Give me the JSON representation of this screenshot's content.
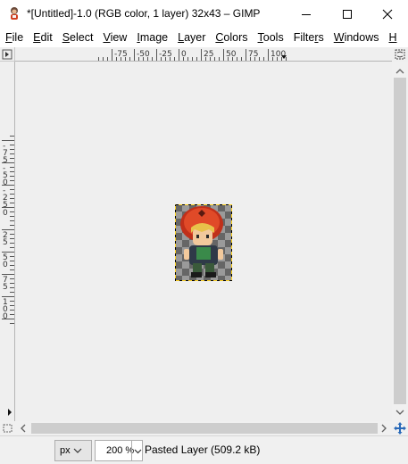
{
  "window": {
    "title": "*[Untitled]-1.0 (RGB color, 1 layer) 32x43 – GIMP"
  },
  "menu": [
    {
      "label_pre": "",
      "label_ul": "F",
      "label_post": "ile"
    },
    {
      "label_pre": "",
      "label_ul": "E",
      "label_post": "dit"
    },
    {
      "label_pre": "",
      "label_ul": "S",
      "label_post": "elect"
    },
    {
      "label_pre": "",
      "label_ul": "V",
      "label_post": "iew"
    },
    {
      "label_pre": "",
      "label_ul": "I",
      "label_post": "mage"
    },
    {
      "label_pre": "",
      "label_ul": "L",
      "label_post": "ayer"
    },
    {
      "label_pre": "",
      "label_ul": "C",
      "label_post": "olors"
    },
    {
      "label_pre": "",
      "label_ul": "T",
      "label_post": "ools"
    },
    {
      "label_pre": "Filte",
      "label_ul": "r",
      "label_post": "s"
    },
    {
      "label_pre": "",
      "label_ul": "W",
      "label_post": "indows"
    },
    {
      "label_pre": "",
      "label_ul": "H",
      "label_post": ""
    }
  ],
  "rulers": {
    "horizontal_labels": [
      "-75",
      "-50",
      "-25",
      "0",
      "25",
      "50",
      "75",
      "100"
    ],
    "vertical_labels": [
      "-75",
      "-50",
      "-25",
      "0",
      "25",
      "50",
      "75",
      "100"
    ]
  },
  "statusbar": {
    "unit": "px",
    "zoom": "200 %",
    "message": "Pasted Layer (509.2 kB)"
  },
  "icons": {
    "app": "gimp-wilber-icon",
    "minimize": "minimize-icon",
    "maximize": "maximize-icon",
    "close": "close-icon",
    "quick_mask": "quick-mask-icon",
    "navigate": "navigate-icon",
    "zoom_fit": "zoom-fit-icon",
    "menu_arrow": "image-menu-arrow-icon"
  }
}
